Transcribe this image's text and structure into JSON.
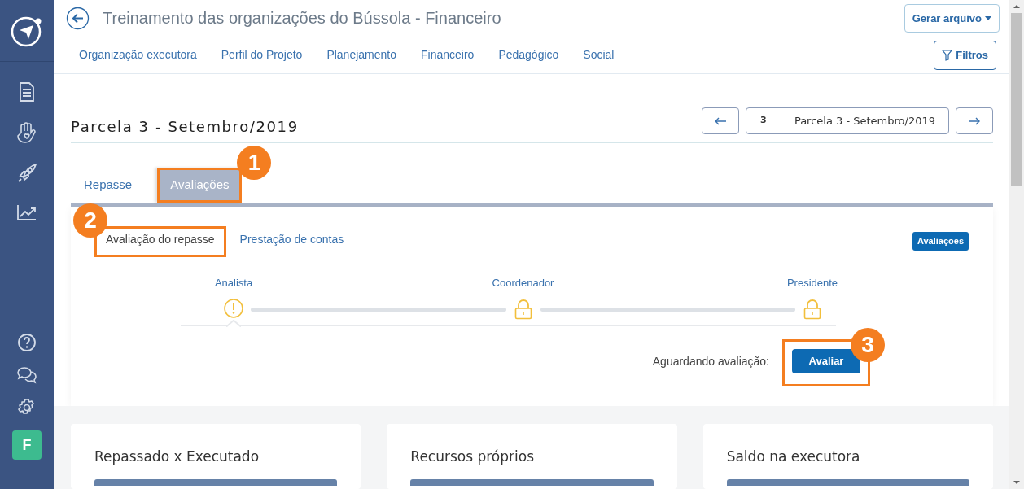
{
  "sidebar": {
    "avatar": "F"
  },
  "header": {
    "title": "Treinamento das organizações do Bússola - Financeiro",
    "export_button": "Gerar arquivo"
  },
  "nav": {
    "items": [
      {
        "label": "Organização executora",
        "selected": false
      },
      {
        "label": "Perfil do Projeto",
        "selected": false
      },
      {
        "label": "Planejamento",
        "selected": false
      },
      {
        "label": "Financeiro",
        "selected": false
      },
      {
        "label": "Pedagógico",
        "selected": false
      },
      {
        "label": "Social",
        "selected": false
      }
    ],
    "filter_button": "Filtros"
  },
  "section": {
    "title": "Parcela 3 - Setembro/2019",
    "pager": {
      "number": "3",
      "label": "Parcela 3 - Setembro/2019"
    }
  },
  "tabs": [
    {
      "label": "Repasse",
      "selected": false
    },
    {
      "label": "Avaliações",
      "selected": true,
      "annotation": "1"
    }
  ],
  "subtabs": [
    {
      "label": "Avaliação do repasse",
      "selected": true,
      "annotation": "2",
      "annotation_left": true
    },
    {
      "label": "Prestação de contas",
      "selected": false
    }
  ],
  "badge": "Avaliações",
  "steps": [
    {
      "label": "Analista",
      "kind": "warning",
      "selected": true
    },
    {
      "label": "Coordenador",
      "kind": "locked",
      "selected": false
    },
    {
      "label": "Presidente",
      "kind": "locked",
      "selected": false
    }
  ],
  "status": {
    "text": "Aguardando avaliação:",
    "button": "Avaliar",
    "annotation": "3"
  },
  "cards": [
    {
      "title": "Repassado x Executado"
    },
    {
      "title": "Recursos próprios"
    },
    {
      "title": "Saldo na executora"
    }
  ]
}
